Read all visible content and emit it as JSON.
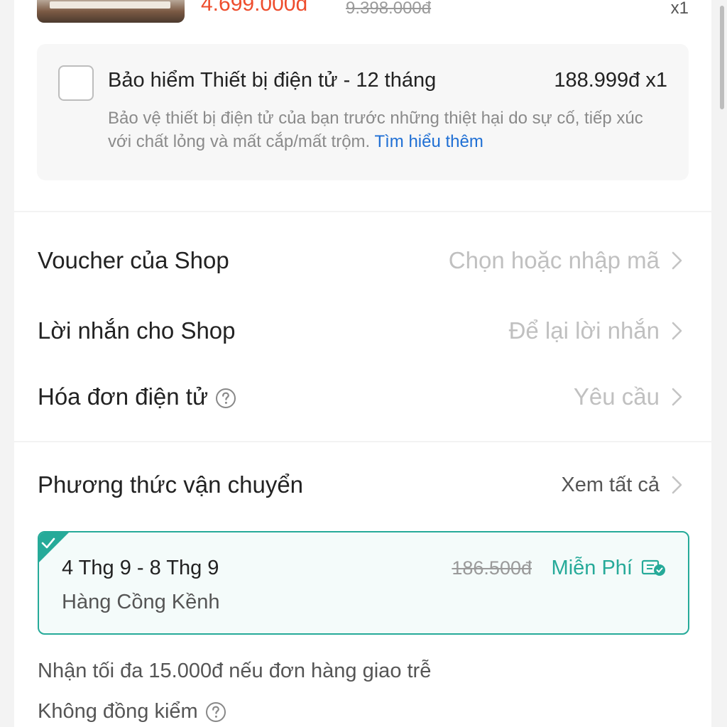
{
  "product": {
    "price": "4.699.000đ",
    "old_price": "9.398.000đ",
    "quantity": "x1"
  },
  "insurance": {
    "title": "Bảo hiểm Thiết bị điện tử - 12 tháng",
    "price_qty": "188.999đ x1",
    "description": "Bảo vệ thiết bị điện tử của bạn trước những thiệt hại do sự cố, tiếp xúc với chất lỏng và mất cắp/mất trộm.",
    "link": "Tìm hiểu thêm",
    "checked": false
  },
  "shop_rows": {
    "voucher": {
      "label": "Voucher của Shop",
      "value": "Chọn hoặc nhập mã"
    },
    "message": {
      "label": "Lời nhắn cho Shop",
      "value": "Để lại lời nhắn"
    },
    "invoice": {
      "label": "Hóa đơn điện tử",
      "value": "Yêu cầu"
    }
  },
  "shipping": {
    "title": "Phương thức vận chuyển",
    "view_all": "Xem tất cả",
    "option": {
      "date_range": "4 Thg 9 - 8 Thg 9",
      "type": "Hàng Cồng Kềnh",
      "old_fee": "186.500đ",
      "fee": "Miễn Phí",
      "selected": true
    },
    "late_note": "Nhận tối đa 15.000đ nếu đơn hàng giao trễ",
    "inspection_note": "Không đồng kiểm"
  },
  "colors": {
    "accent_orange": "#ee4d2d",
    "accent_teal": "#26aa99",
    "link_blue": "#1f6fd4"
  }
}
